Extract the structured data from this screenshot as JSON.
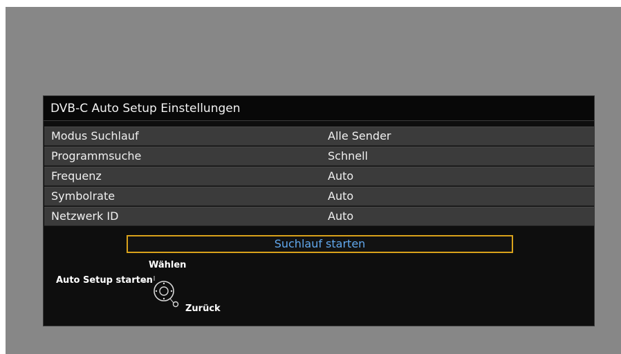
{
  "dialog": {
    "title": "DVB-C Auto Setup Einstellungen",
    "rows": [
      {
        "label": "Modus Suchlauf",
        "value": "Alle Sender"
      },
      {
        "label": "Programmsuche",
        "value": "Schnell"
      },
      {
        "label": "Frequenz",
        "value": "Auto"
      },
      {
        "label": "Symbolrate",
        "value": "Auto"
      },
      {
        "label": "Netzwerk ID",
        "value": "Auto"
      }
    ],
    "start_button": "Suchlauf starten"
  },
  "hints": {
    "select": "Wählen",
    "start": "Auto Setup starten",
    "back": "Zurück",
    "joystick_icon": "navigation-joystick-icon"
  },
  "colors": {
    "background": "#878787",
    "dialog": "#0e0e0e",
    "row": "#3b3b3b",
    "accent_border": "#d9a21b",
    "button_text": "#61a8ee"
  }
}
